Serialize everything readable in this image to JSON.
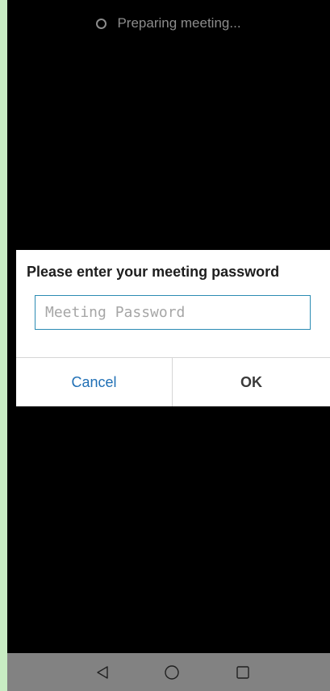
{
  "status": {
    "text": "Preparing meeting...",
    "icon": "spinner-icon"
  },
  "dialog": {
    "title": "Please enter your meeting password",
    "password_placeholder": "Meeting Password",
    "password_value": "",
    "cancel_label": "Cancel",
    "ok_label": "OK"
  },
  "navbar": {
    "back_icon": "back-triangle-icon",
    "home_icon": "home-circle-icon",
    "recents_icon": "recents-square-icon"
  },
  "colors": {
    "background": "#000000",
    "dialog_background": "#ffffff",
    "input_border": "#2b8bb3",
    "cancel_text": "#1f6fb5",
    "navbar": "#828282",
    "side_strip": "#c8ecc3"
  }
}
